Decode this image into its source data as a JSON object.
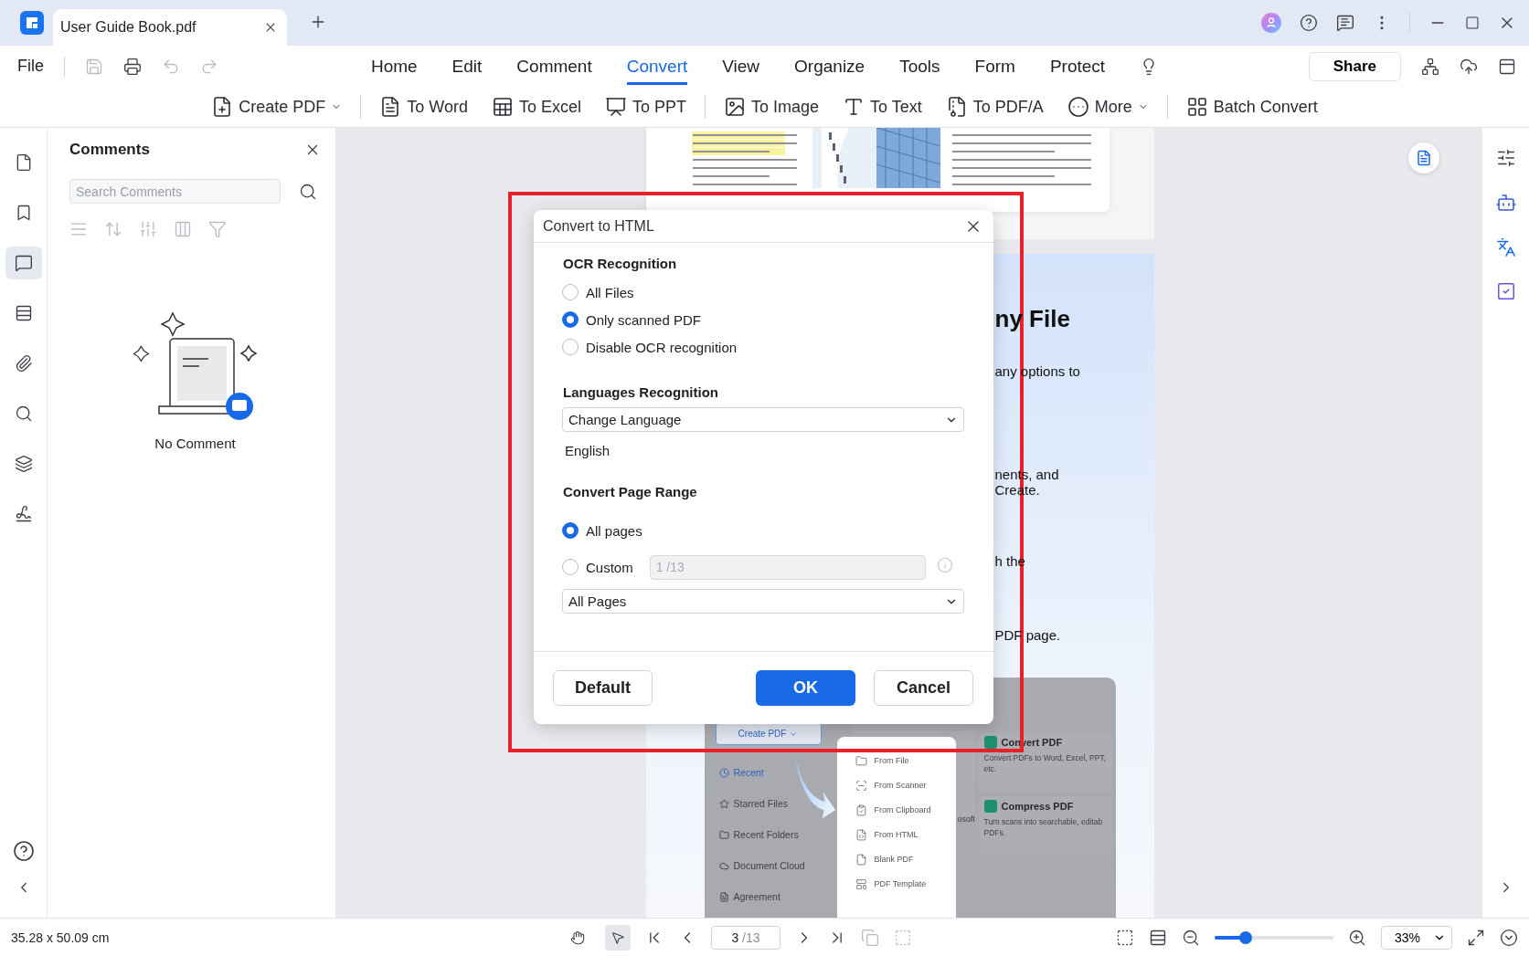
{
  "title_bar": {
    "tabs": [
      {
        "title": "User Guide Book.pdf",
        "selected": true
      }
    ]
  },
  "menu": {
    "file": "File",
    "tabs": [
      {
        "label": "Home",
        "selected": false
      },
      {
        "label": "Edit",
        "selected": false
      },
      {
        "label": "Comment",
        "selected": false
      },
      {
        "label": "Convert",
        "selected": true
      },
      {
        "label": "View",
        "selected": false
      },
      {
        "label": "Organize",
        "selected": false
      },
      {
        "label": "Tools",
        "selected": false
      },
      {
        "label": "Form",
        "selected": false
      },
      {
        "label": "Protect",
        "selected": false
      }
    ],
    "share": "Share"
  },
  "toolbar": {
    "groups": [
      [
        {
          "label": "Create PDF",
          "kind": "dropdown"
        }
      ],
      [
        {
          "label": "To Word",
          "kind": "button"
        },
        {
          "label": "To Excel",
          "kind": "button"
        },
        {
          "label": "To PPT",
          "kind": "button"
        }
      ],
      [
        {
          "label": "To Image",
          "kind": "button"
        },
        {
          "label": "To Text",
          "kind": "button"
        },
        {
          "label": "To PDF/A",
          "kind": "button"
        },
        {
          "label": "More",
          "kind": "dropdown"
        }
      ],
      [
        {
          "label": "Batch Convert",
          "kind": "button"
        }
      ]
    ]
  },
  "left_rail": [
    {
      "selected": false
    },
    {
      "selected": false
    },
    {
      "selected": true
    },
    {
      "selected": false
    },
    {
      "selected": false
    },
    {
      "selected": false
    },
    {
      "selected": false
    },
    {
      "selected": false
    }
  ],
  "comments_panel": {
    "title": "Comments",
    "search": {
      "placeholder": "Search Comments"
    },
    "empty_text": "No Comment"
  },
  "document": {
    "page_fragments": [
      {
        "text": "ny File",
        "kind": "heading"
      },
      {
        "text": "any options to",
        "kind": "line"
      },
      {
        "text": "nents, and",
        "kind": "line"
      },
      {
        "text": "Create.",
        "kind": "line"
      },
      {
        "text": "h the",
        "kind": "line"
      },
      {
        "text": "PDF page.",
        "kind": "line"
      }
    ],
    "embedded_screenshot": {
      "create_button": "Create PDF",
      "nav": [
        {
          "label": "Recent",
          "selected": true
        },
        {
          "label": "Starred Files",
          "selected": false
        },
        {
          "label": "Recent Folders",
          "selected": false
        },
        {
          "label": "Document Cloud",
          "selected": false
        },
        {
          "label": "Agreement",
          "selected": false
        }
      ],
      "menu": [
        "From File",
        "From Scanner",
        "From Clipboard",
        "From HTML",
        "Blank PDF",
        "PDF Template"
      ],
      "cards": [
        {
          "title": "Convert PDF",
          "description": "Convert PDFs to Word, Excel, PPT, etc."
        },
        {
          "title": "Compress PDF",
          "description": "Turn scans into searchable, editab PDFs."
        }
      ],
      "fragment": "osoft"
    }
  },
  "dialog": {
    "title": "Convert to HTML",
    "ocr": {
      "heading": "OCR Recognition",
      "options": [
        {
          "label": "All Files",
          "selected": false
        },
        {
          "label": "Only scanned PDF",
          "selected": true
        },
        {
          "label": "Disable OCR recognition",
          "selected": false
        }
      ]
    },
    "languages": {
      "heading": "Languages Recognition",
      "select": "Change Language",
      "selected_language": "English"
    },
    "page_range": {
      "heading": "Convert Page Range",
      "options": [
        {
          "label": "All pages",
          "selected": true
        },
        {
          "label": "Custom",
          "selected": false
        }
      ],
      "custom_field": {
        "placeholder": "1 /13",
        "disabled": true
      },
      "range_select": "All Pages"
    },
    "buttons": [
      {
        "label": "Default",
        "kind": "secondary"
      },
      {
        "label": "OK",
        "kind": "primary"
      },
      {
        "label": "Cancel",
        "kind": "secondary"
      }
    ]
  },
  "status_bar": {
    "dimensions": "35.28 x 50.09 cm",
    "tools": [
      {
        "selected": false
      },
      {
        "selected": true
      }
    ],
    "page": {
      "value": "3",
      "total": "/13"
    },
    "zoom": {
      "level": 0.26,
      "value": "33%"
    }
  }
}
